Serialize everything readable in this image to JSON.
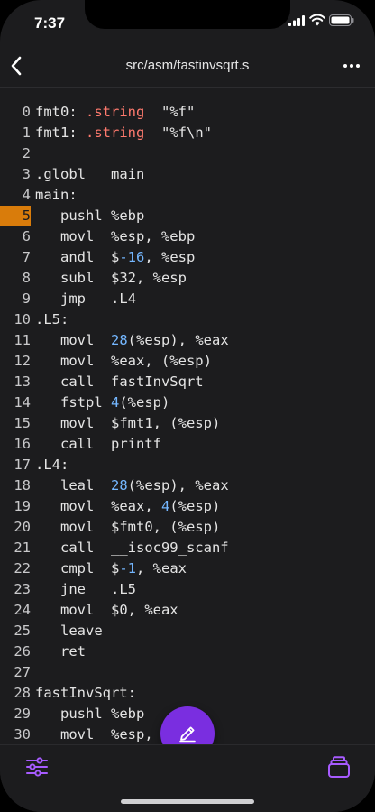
{
  "status": {
    "time": "7:37"
  },
  "nav": {
    "title": "src/asm/fastinvsqrt.s"
  },
  "code": {
    "highlight_line": 5,
    "lines": [
      [
        {
          "t": "fmt0: "
        },
        {
          "t": ".string",
          "c": "kw"
        },
        {
          "t": "  \"%f\""
        }
      ],
      [
        {
          "t": "fmt1: "
        },
        {
          "t": ".string",
          "c": "kw"
        },
        {
          "t": "  \"%f\\n\""
        }
      ],
      [
        {
          "t": ""
        }
      ],
      [
        {
          "t": ".globl   main"
        }
      ],
      [
        {
          "t": "main:"
        }
      ],
      [
        {
          "t": "   pushl %ebp"
        }
      ],
      [
        {
          "t": "   movl  %esp, %ebp"
        }
      ],
      [
        {
          "t": "   andl  $"
        },
        {
          "t": "-16",
          "c": "num"
        },
        {
          "t": ", %esp"
        }
      ],
      [
        {
          "t": "   subl  $32, %esp"
        }
      ],
      [
        {
          "t": "   jmp   .L4"
        }
      ],
      [
        {
          "t": ".L5:"
        }
      ],
      [
        {
          "t": "   movl  "
        },
        {
          "t": "28",
          "c": "num"
        },
        {
          "t": "(%esp), %eax"
        }
      ],
      [
        {
          "t": "   movl  %eax, (%esp)"
        }
      ],
      [
        {
          "t": "   call  fastInvSqrt"
        }
      ],
      [
        {
          "t": "   fstpl "
        },
        {
          "t": "4",
          "c": "num"
        },
        {
          "t": "(%esp)"
        }
      ],
      [
        {
          "t": "   movl  $fmt1, (%esp)"
        }
      ],
      [
        {
          "t": "   call  printf"
        }
      ],
      [
        {
          "t": ".L4:"
        }
      ],
      [
        {
          "t": "   leal  "
        },
        {
          "t": "28",
          "c": "num"
        },
        {
          "t": "(%esp), %eax"
        }
      ],
      [
        {
          "t": "   movl  %eax, "
        },
        {
          "t": "4",
          "c": "num"
        },
        {
          "t": "(%esp)"
        }
      ],
      [
        {
          "t": "   movl  $fmt0, (%esp)"
        }
      ],
      [
        {
          "t": "   call  __isoc99_scanf"
        }
      ],
      [
        {
          "t": "   cmpl  $"
        },
        {
          "t": "-1",
          "c": "num"
        },
        {
          "t": ", %eax"
        }
      ],
      [
        {
          "t": "   jne   .L5"
        }
      ],
      [
        {
          "t": "   movl  $0, %eax"
        }
      ],
      [
        {
          "t": "   leave"
        }
      ],
      [
        {
          "t": "   ret"
        }
      ],
      [
        {
          "t": ""
        }
      ],
      [
        {
          "t": "fastInvSqrt:"
        }
      ],
      [
        {
          "t": "   pushl %ebp"
        }
      ],
      [
        {
          "t": "   movl  %esp, %ebp"
        }
      ]
    ]
  },
  "colors": {
    "accent": "#7a2ee0",
    "highlight": "#d97c0b",
    "keyword": "#ff7a6e",
    "number": "#74b7ff",
    "background": "#1c1c1e"
  },
  "icons": {
    "back": "chevron-left-icon",
    "more": "ellipsis-icon",
    "settings": "sliders-icon",
    "edit": "pencil-icon",
    "files": "stack-icon"
  }
}
